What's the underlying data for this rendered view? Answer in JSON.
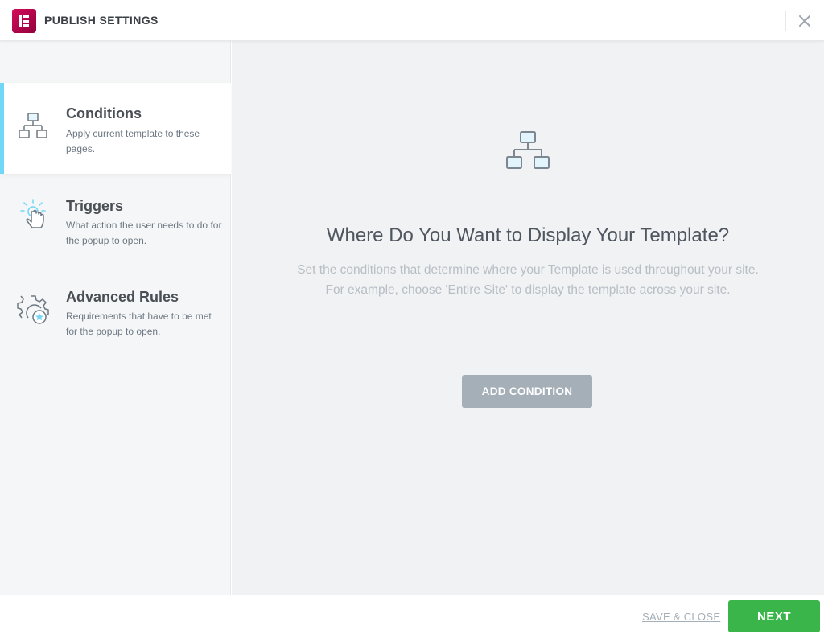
{
  "header": {
    "title": "PUBLISH SETTINGS",
    "logo_icon": "elementor-logo-icon",
    "close_icon": "close-icon"
  },
  "sidebar": {
    "items": [
      {
        "title": "Conditions",
        "description": "Apply current template to these pages.",
        "icon": "sitemap-icon",
        "active": true
      },
      {
        "title": "Triggers",
        "description": "What action the user needs to do for the popup to open.",
        "icon": "pointer-click-icon",
        "active": false
      },
      {
        "title": "Advanced Rules",
        "description": "Requirements that have to be met for the popup to open.",
        "icon": "gear-star-icon",
        "active": false
      }
    ]
  },
  "main": {
    "icon": "sitemap-icon",
    "title": "Where Do You Want to Display Your Template?",
    "description_line1": "Set the conditions that determine where your Template is used throughout your site.",
    "description_line2": "For example, choose 'Entire Site' to display the template across your site.",
    "add_button": "ADD CONDITION"
  },
  "footer": {
    "save_close": "SAVE & CLOSE",
    "next": "NEXT"
  },
  "colors": {
    "accent": "#71d7f7",
    "brand": "#d30c5c",
    "next_button": "#39b54a",
    "add_button": "#a4afb7"
  }
}
